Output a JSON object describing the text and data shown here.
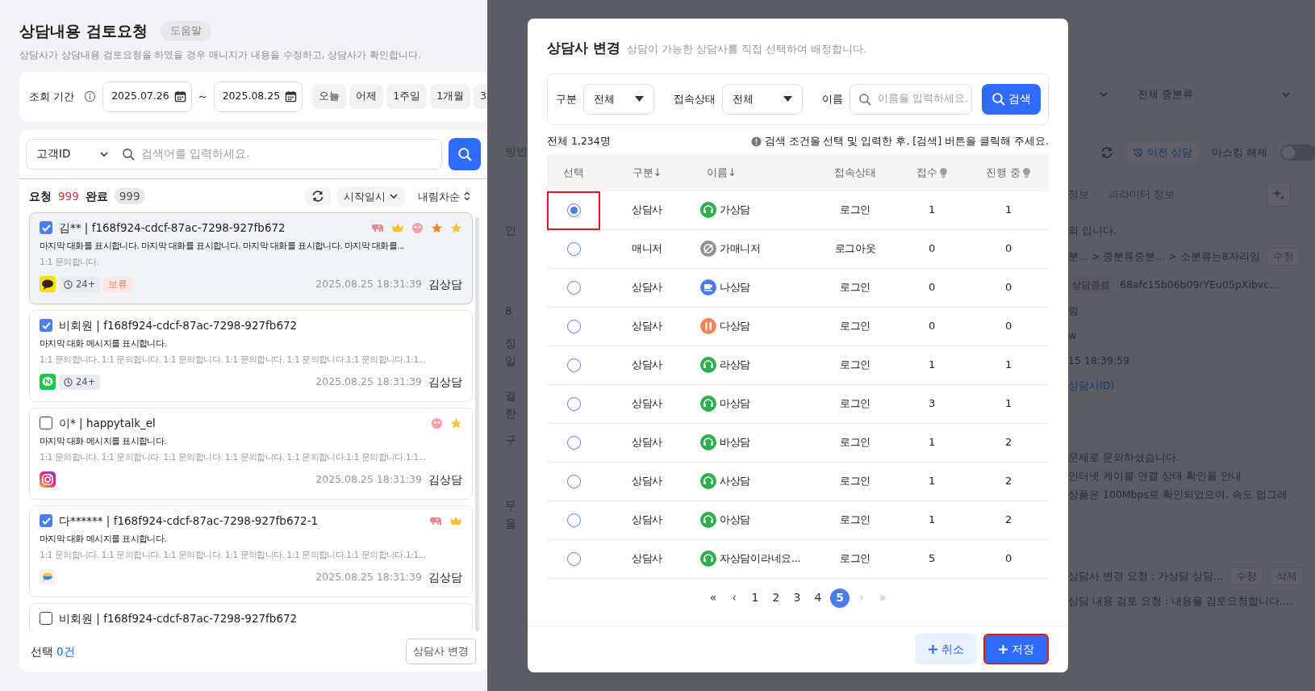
{
  "page": {
    "title": "상담내용 검토요청",
    "help_button": "도움말",
    "description": "상담사가 상담내용 검토요청을 하였을 경우 매니지가 내용을 수정하고, 상담사가 확인합니다."
  },
  "period_filter": {
    "label": "조회 기간",
    "start_date": "2025.07.26",
    "separator": "~",
    "end_date": "2025.08.25",
    "quick_ranges": [
      "오늘",
      "어제",
      "1주일",
      "1개월",
      "3"
    ]
  },
  "search": {
    "field_select": "고객ID",
    "placeholder": "검색어를 입력하세요."
  },
  "counts": [
    {
      "label": "요청",
      "count": "999",
      "kind": "alert"
    },
    {
      "label": "완료",
      "count": "999",
      "kind": "muted"
    }
  ],
  "sort": {
    "field": "시작일시",
    "order": "내림차순"
  },
  "requests": [
    {
      "checked": true,
      "selected": true,
      "title": "김** | f168f924-cdcf-87ac-7298-927fb672",
      "tags": [
        {
          "kind": "elephant"
        },
        {
          "kind": "crown"
        },
        {
          "kind": "emoji"
        },
        {
          "kind": "star",
          "color": "#f0862a"
        },
        {
          "kind": "star",
          "color": "#f6c134"
        }
      ],
      "last_message": "마지막 대화를 표시합니다.  마지막 대화를 표시합니다. 마지막 대화를 표시합니다. 마지막 대화를...",
      "inquiry": "1:1 문의합니다.",
      "channel": {
        "kind": "kakao"
      },
      "badges": [
        {
          "kind": "wait",
          "text": "24+"
        },
        {
          "kind": "hold",
          "text": "보류"
        }
      ],
      "timestamp": "2025.08.25 18:31:39",
      "agent": "김상담"
    },
    {
      "checked": true,
      "selected": false,
      "title": "비회원 | f168f924-cdcf-87ac-7298-927fb672",
      "last_message": "마지막 대화 메시지를 표시합니다.",
      "inquiry": "1:1 문의합니다. 1:1 문의합니다. 1:1 문의합니다. 1:1 문의합니다. 1:1 문의합니다.1:1 문의합니다.1:1...",
      "channel": {
        "kind": "line"
      },
      "badges": [
        {
          "kind": "wait",
          "text": "24+"
        }
      ],
      "timestamp": "2025.08.25 18:31:39",
      "agent": "김상담"
    },
    {
      "checked": false,
      "selected": false,
      "title": "이* | happytalk_el",
      "tags": [
        {
          "kind": "emoji"
        },
        {
          "kind": "star",
          "color": "#f6c134"
        }
      ],
      "last_message": "마지막 대화 메시지를 표시합니다.",
      "inquiry": "1:1 문의합니다. 1:1 문의합니다. 1:1 문의합니다. 1:1 문의합니다. 1:1 문의합니다.1:1 문의합니다.1:1...",
      "channel": {
        "kind": "instagram"
      },
      "timestamp": "2025.08.25 18:31:39",
      "agent": "김상담"
    },
    {
      "checked": true,
      "selected": false,
      "title": "다****** | f168f924-cdcf-87ac-7298-927fb672-1",
      "tags": [
        {
          "kind": "elephant"
        },
        {
          "kind": "crown"
        }
      ],
      "last_message": "마지막 대화 메시지를 표시합니다.",
      "inquiry": "1:1 문의합니다. 1:1 문의합니다. 1:1 문의합니다. 1:1 문의합니다. 1:1 문의합니다.1:1 문의합니다.1:1...",
      "channel": {
        "kind": "bubble"
      },
      "timestamp": "2025.08.25 18:31:39",
      "agent": "김상담"
    },
    {
      "checked": false,
      "selected": false,
      "title": "비회원 | f168f924-cdcf-87ac-7298-927fb672"
    }
  ],
  "footer": {
    "selected_label": "선택",
    "selected_count": "0건",
    "change_button": "상담사 변경"
  },
  "background": {
    "left_fragments": [
      "방번",
      "인",
      "8",
      "징",
      "일",
      "결",
      "한",
      "구",
      "무",
      "을"
    ],
    "subcategory_select": "전체 중분류",
    "history_button": "이전 상담",
    "masking_label": "마스킹 해제",
    "masking_on": false,
    "tabs": [
      "정보",
      "파라미터 정보"
    ],
    "lines": [
      {
        "kind": "text",
        "text": "의 입니다."
      },
      {
        "kind": "text",
        "text": "분... > 중분류중분... > 소분류는8자리임",
        "buttons": [
          "수정"
        ]
      },
      {
        "kind": "badge",
        "badge": "상담종료",
        "text": "68afc15b06b09rYEu05pXibvc..."
      },
      {
        "kind": "text",
        "text": "럼"
      },
      {
        "kind": "text",
        "text": "w"
      },
      {
        "kind": "text",
        "text": "15 18:39:59"
      },
      {
        "kind": "link",
        "text": "상담사ID)"
      },
      {
        "kind": "text",
        "text": "문제로 문의하셨습니다."
      },
      {
        "kind": "text",
        "text": "인터넷 케이블 연결 상태 확인을 안내"
      },
      {
        "kind": "text",
        "text": "상품은 100Mbps로 확인되었으며, 속도 업그레"
      },
      {
        "kind": "text",
        "text": "상담사 변경 요청 : 가상담 상담...",
        "buttons": [
          "수정",
          "삭제"
        ]
      },
      {
        "kind": "text",
        "text": "상담 내용 검토 요청 : 내용을 검토요청합니다...."
      }
    ]
  },
  "modal": {
    "title": "상담사 변경",
    "subtitle": "상담이 가능한 상담사를 직접 선택하여 배정합니다.",
    "filters": {
      "type_label": "구분",
      "type_value": "전체",
      "status_label": "접속상태",
      "status_value": "전체",
      "name_label": "이름",
      "name_placeholder": "이름을 입력하세요.",
      "search_button": "검색"
    },
    "total": "전체 1,234명",
    "hint": "검색 조건을 선택 및 입력한 후, [검색] 버튼을 클릭해 주세요.",
    "columns": [
      {
        "label": "선택",
        "hint_icon": false
      },
      {
        "label": "구분↓",
        "hint_icon": false
      },
      {
        "label": "이름↓",
        "hint_icon": false
      },
      {
        "label": "접속상태",
        "hint_icon": false
      },
      {
        "label": "접수",
        "hint_icon": true
      },
      {
        "label": "진행 중",
        "hint_icon": true
      }
    ],
    "rows": [
      {
        "selected": true,
        "highlighted": true,
        "role": "상담사",
        "avatar": {
          "kind": "headset"
        },
        "name": "가상담",
        "status": "로그인",
        "received": "1",
        "in_progress": "1"
      },
      {
        "selected": false,
        "highlighted": false,
        "role": "매니저",
        "avatar": {
          "kind": "offline"
        },
        "name": "가매니저",
        "status": "로그아웃",
        "received": "0",
        "in_progress": "0"
      },
      {
        "selected": false,
        "highlighted": false,
        "role": "상담사",
        "avatar": {
          "kind": "coffee"
        },
        "name": "나상담",
        "status": "로그인",
        "received": "0",
        "in_progress": "0"
      },
      {
        "selected": false,
        "highlighted": false,
        "role": "상담사",
        "avatar": {
          "kind": "meal"
        },
        "name": "다상담",
        "status": "로그인",
        "received": "0",
        "in_progress": "0"
      },
      {
        "selected": false,
        "highlighted": false,
        "role": "상담사",
        "avatar": {
          "kind": "headset"
        },
        "name": "라상담",
        "status": "로그인",
        "received": "1",
        "in_progress": "1"
      },
      {
        "selected": false,
        "highlighted": false,
        "role": "상담사",
        "avatar": {
          "kind": "headset"
        },
        "name": "마상담",
        "status": "로그인",
        "received": "3",
        "in_progress": "1"
      },
      {
        "selected": false,
        "highlighted": false,
        "role": "상담사",
        "avatar": {
          "kind": "headset"
        },
        "name": "바상담",
        "status": "로그인",
        "received": "1",
        "in_progress": "2"
      },
      {
        "selected": false,
        "highlighted": false,
        "role": "상담사",
        "avatar": {
          "kind": "headset"
        },
        "name": "사상담",
        "status": "로그인",
        "received": "1",
        "in_progress": "2"
      },
      {
        "selected": false,
        "highlighted": false,
        "role": "상담사",
        "avatar": {
          "kind": "headset"
        },
        "name": "아상담",
        "status": "로그인",
        "received": "1",
        "in_progress": "2"
      },
      {
        "selected": false,
        "highlighted": false,
        "role": "상담사",
        "avatar": {
          "kind": "headset"
        },
        "name": "자상담이라네요...",
        "status": "로그인",
        "received": "5",
        "in_progress": "0"
      }
    ],
    "pagination": {
      "before": [
        {
          "label": "«",
          "disabled": false
        },
        {
          "label": "‹",
          "disabled": false
        }
      ],
      "pages": [
        {
          "label": "1",
          "selected": false
        },
        {
          "label": "2",
          "selected": false
        },
        {
          "label": "3",
          "selected": false
        },
        {
          "label": "4",
          "selected": false
        },
        {
          "label": "5",
          "selected": true
        }
      ],
      "after": [
        {
          "label": "›",
          "disabled": true
        },
        {
          "label": "»",
          "disabled": true
        }
      ]
    },
    "buttons": [
      {
        "label": "취소",
        "kind": "secondary",
        "highlighted": false
      },
      {
        "label": "저장",
        "kind": "primary",
        "highlighted": true
      }
    ]
  }
}
